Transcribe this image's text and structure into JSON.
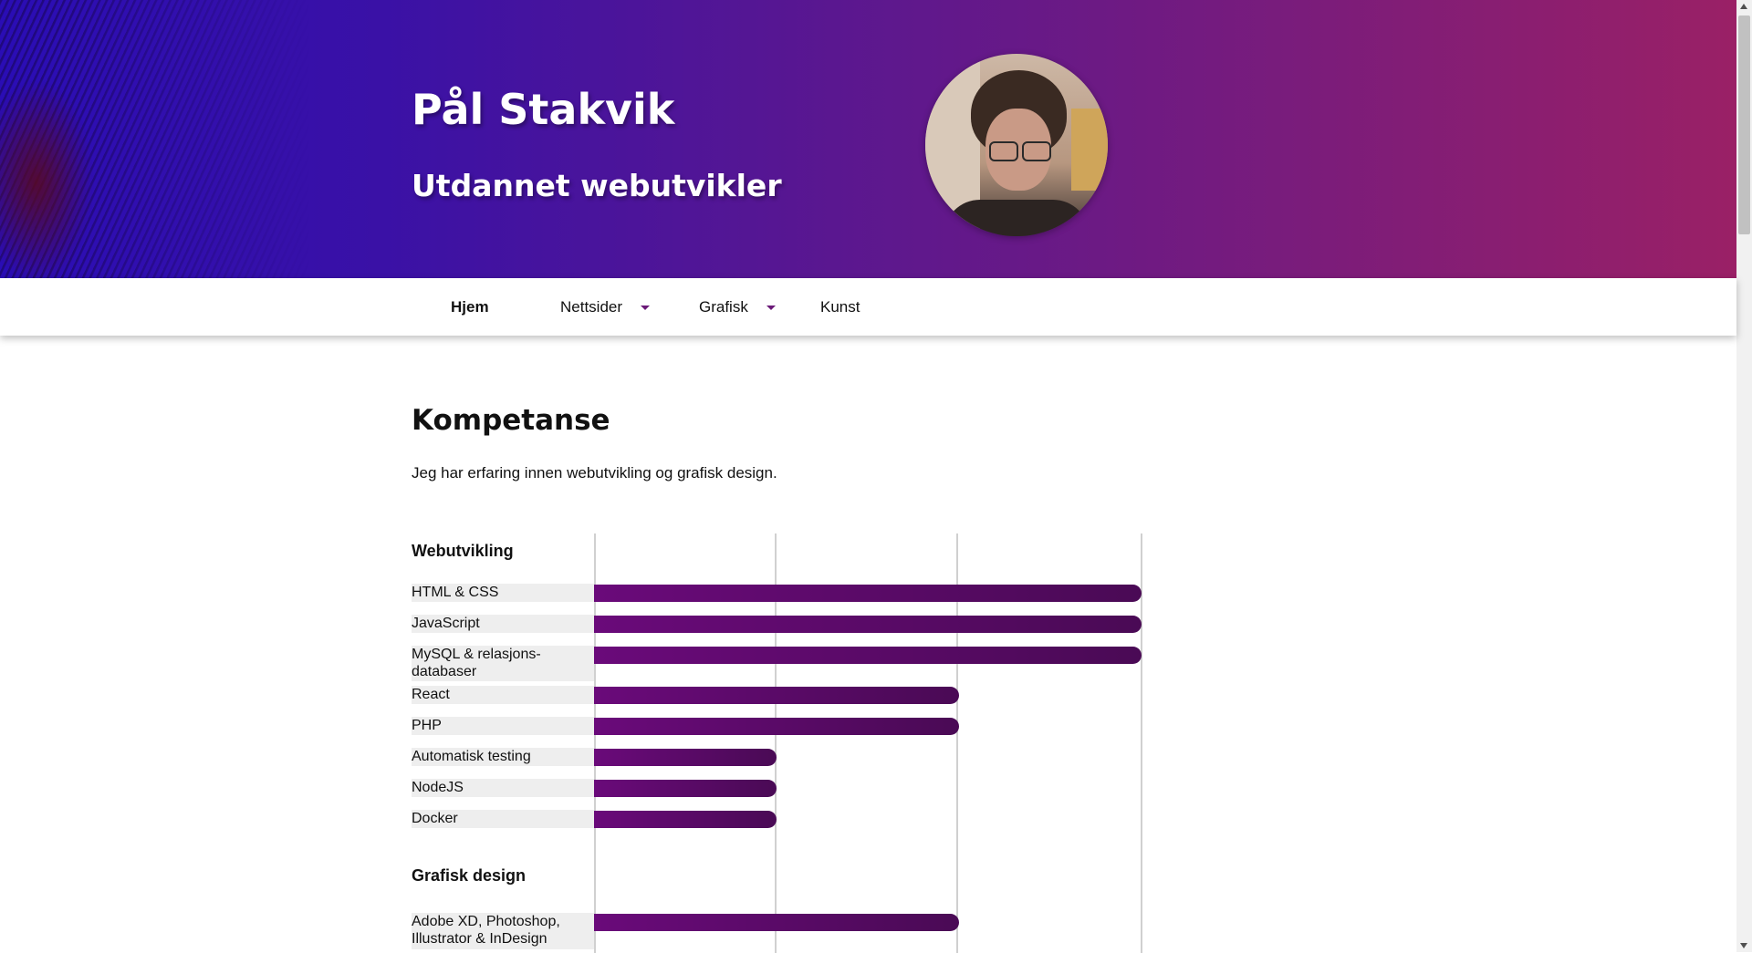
{
  "header": {
    "name": "Pål Stakvik",
    "subtitle": "Utdannet webutvikler"
  },
  "nav": {
    "items": [
      {
        "label": "Hjem",
        "active": true,
        "dropdown": false
      },
      {
        "label": "Nettsider",
        "active": false,
        "dropdown": true
      },
      {
        "label": "Grafisk",
        "active": false,
        "dropdown": true
      },
      {
        "label": "Kunst",
        "active": false,
        "dropdown": false
      }
    ]
  },
  "main": {
    "title": "Kompetanse",
    "intro": "Jeg har erfaring innen webutvikling og grafisk design."
  },
  "skills": {
    "max_level": 3,
    "categories": [
      {
        "name": "Webutvikling",
        "items": [
          {
            "label": "HTML & CSS",
            "level": 3
          },
          {
            "label": "JavaScript",
            "level": 3
          },
          {
            "label": "MySQL & relasjons-databaser",
            "level": 3
          },
          {
            "label": "React",
            "level": 2
          },
          {
            "label": "PHP",
            "level": 2
          },
          {
            "label": "Automatisk testing",
            "level": 1
          },
          {
            "label": "NodeJS",
            "level": 1
          },
          {
            "label": "Docker",
            "level": 1
          }
        ]
      },
      {
        "name": "Grafisk design",
        "items": [
          {
            "label": "Adobe XD, Photoshop, Illustrator & InDesign",
            "level": 2
          }
        ]
      }
    ]
  }
}
